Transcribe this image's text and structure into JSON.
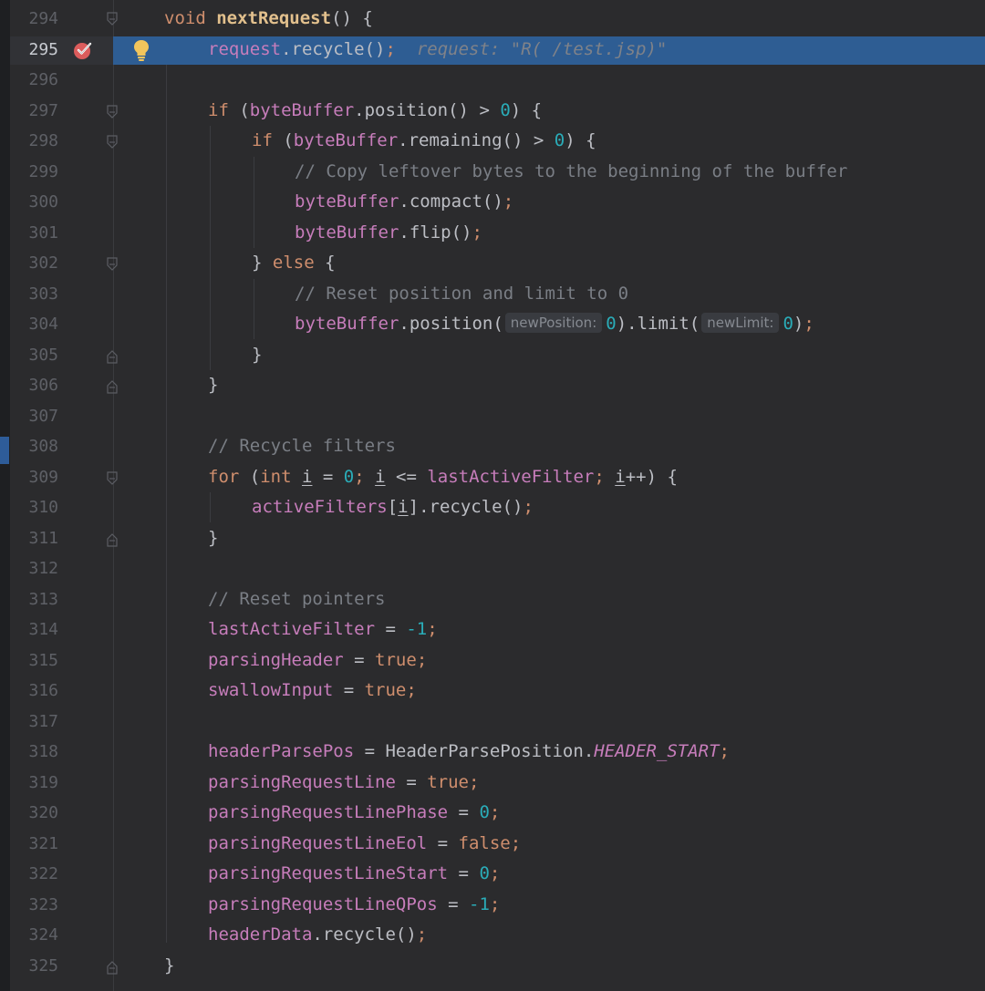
{
  "editor": {
    "theme_colors": {
      "background": "#2b2b2d",
      "execution_line": "#2e5d93",
      "keyword": "#cf8e6d",
      "field": "#c77dbb",
      "number": "#2aacb8",
      "comment": "#7a7e85",
      "method_decl": "#e2c08d"
    },
    "line_numbers": [
      "294",
      "295",
      "296",
      "297",
      "298",
      "299",
      "300",
      "301",
      "302",
      "303",
      "304",
      "305",
      "306",
      "307",
      "308",
      "309",
      "310",
      "311",
      "312",
      "313",
      "314",
      "315",
      "316",
      "317",
      "318",
      "319",
      "320",
      "321",
      "322",
      "323",
      "324",
      "325"
    ],
    "current_line": "295",
    "breakpoint_icon": "breakpoint-check-icon",
    "intention_icon": "lightbulb-icon",
    "lines": {
      "l294": {
        "kw": "void",
        "name": "nextRequest",
        "rest": "() {"
      },
      "l295": {
        "field": "request",
        "call": ".recycle()",
        "semi": ";",
        "inline_value": "request: \"R( /test.jsp)\""
      },
      "l297": {
        "kw": "if",
        "open": " (",
        "field": "byteBuffer",
        "call": ".position() > ",
        "num": "0",
        "close": ") {"
      },
      "l298": {
        "kw": "if",
        "open": " (",
        "field": "byteBuffer",
        "call": ".remaining() > ",
        "num": "0",
        "close": ") {"
      },
      "l299": {
        "comment": "// Copy leftover bytes to the beginning of the buffer"
      },
      "l300": {
        "field": "byteBuffer",
        "call": ".compact()",
        "semi": ";"
      },
      "l301": {
        "field": "byteBuffer",
        "call": ".flip()",
        "semi": ";"
      },
      "l302": {
        "brace": "} ",
        "kw": "else",
        "rest": " {"
      },
      "l303": {
        "comment": "// Reset position and limit to 0"
      },
      "l304": {
        "field": "byteBuffer",
        "call1": ".position(",
        "hint1": "newPosition:",
        "num1": "0",
        "call2": ").limit(",
        "hint2": "newLimit:",
        "num2": "0",
        "close": ")",
        "semi": ";"
      },
      "l305": {
        "brace": "}"
      },
      "l306": {
        "brace": "}"
      },
      "l308": {
        "comment": "// Recycle filters"
      },
      "l309": {
        "kw": "for",
        "p1": " (",
        "kw2": "int",
        "var1": "i",
        "p2": " = ",
        "num": "0",
        "semi1": "; ",
        "var2": "i",
        "p3": " <= ",
        "field": "lastActiveFilter",
        "semi2": "; ",
        "var3": "i",
        "p4": "++) {"
      },
      "l310": {
        "field": "activeFilters",
        "p1": "[",
        "var": "i",
        "p2": "].recycle()",
        "semi": ";"
      },
      "l311": {
        "brace": "}"
      },
      "l313": {
        "comment": "// Reset pointers"
      },
      "l314": {
        "field": "lastActiveFilter",
        "op": " = ",
        "num": "-1",
        "semi": ";"
      },
      "l315": {
        "field": "parsingHeader",
        "op": " = ",
        "kw": "true",
        "semi": ";"
      },
      "l316": {
        "field": "swallowInput",
        "op": " = ",
        "kw": "true",
        "semi": ";"
      },
      "l318": {
        "field": "headerParsePos",
        "op": " = HeaderParsePosition.",
        "const": "HEADER_START",
        "semi": ";"
      },
      "l319": {
        "field": "parsingRequestLine",
        "op": " = ",
        "kw": "true",
        "semi": ";"
      },
      "l320": {
        "field": "parsingRequestLinePhase",
        "op": " = ",
        "num": "0",
        "semi": ";"
      },
      "l321": {
        "field": "parsingRequestLineEol",
        "op": " = ",
        "kw": "false",
        "semi": ";"
      },
      "l322": {
        "field": "parsingRequestLineStart",
        "op": " = ",
        "num": "0",
        "semi": ";"
      },
      "l323": {
        "field": "parsingRequestLineQPos",
        "op": " = ",
        "num": "-1",
        "semi": ";"
      },
      "l324": {
        "field": "headerData",
        "call": ".recycle()",
        "semi": ";"
      },
      "l325": {
        "brace": "}"
      }
    }
  }
}
